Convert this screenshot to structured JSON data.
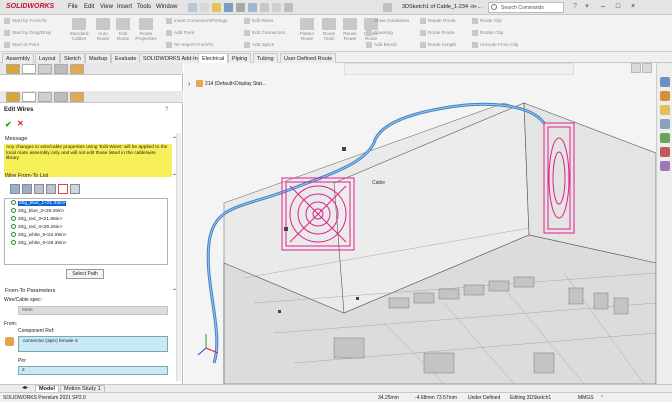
{
  "app": {
    "logo": "SOLIDWORKS",
    "document_title": "3DSketch1 of Cable_1-234 -in-...",
    "search_placeholder": "Search Commands"
  },
  "menu": [
    "File",
    "Edit",
    "View",
    "Insert",
    "Tools",
    "Window"
  ],
  "ribbon": {
    "col1": [
      "Start by From/To",
      "Start by Drag/Drop",
      "Start at Point"
    ],
    "big1": [
      {
        "label": "Standard\nCables"
      },
      {
        "label": "Auto\nRoute"
      },
      {
        "label": "Edit\nRoute"
      },
      {
        "label": "Route\nProperties"
      }
    ],
    "col2": [
      "Insert Connectors/Fittings",
      "Add Point",
      "Re-Import From/To"
    ],
    "col3": [
      "Edit Wires",
      "Edit Connectors",
      "Add Splice"
    ],
    "big2": [
      {
        "label": "Flatten\nRoute"
      },
      {
        "label": "Route\nTools"
      },
      {
        "label": "Reuse\nRoute"
      },
      {
        "label": "Create\nRoute"
      }
    ],
    "col4": [
      "Show Guidelines",
      "Covering",
      "Add Bends"
    ],
    "col5": [
      "Repair Route",
      "Route Route",
      "Route Length"
    ],
    "col6": [
      "Route Clip",
      "Rotate Clip",
      "Unroute From Clip"
    ]
  },
  "tabs": [
    "Assembly",
    "Layout",
    "Sketch",
    "Markup",
    "Evaluate",
    "SOLIDWORKS Add-Ins",
    "Electrical",
    "Piping",
    "Tubing",
    "User Defined Route"
  ],
  "active_tab": "Electrical",
  "panel": {
    "title": "Edit Wires",
    "message_header": "Message",
    "message": "Any changes to wire/cable properties using 'Edit Wires' will be applied to the local route assembly only and will not edit those listed in the cable/wire library",
    "wire_list_header": "Wire From-To List",
    "wires": [
      "20g_blue_1<21.33in>",
      "20g_blue_2<29.26in>",
      "20g_red_3<21.96in>",
      "20g_red_4<29.26in>",
      "20g_white_5<22.05in>",
      "20g_white_6<29.35in>"
    ],
    "select_path": "Select Path",
    "params_header": "From-To Parameters",
    "spec_label": "Wire/Cable spec:",
    "spec_value": "9965",
    "from_label": "From:",
    "comp_ref_label": "Component Ref:",
    "comp_ref_value": "connector (3pin) female-3",
    "pin_label": "Pin:",
    "pin_value": "2"
  },
  "viewport": {
    "tree_label": "214 (Default<Display Stat...",
    "cable_label": "Cable"
  },
  "bottom_tabs": [
    "Model",
    "Motion Study 1"
  ],
  "status": {
    "product": "SOLIDWORKS Premium 2021 SP2.0",
    "x": "34.25mm",
    "y": "-4.68mm 73.57mm",
    "mode": "Under Defined",
    "editing": "Editing 3DSketch1",
    "units": "MMGS"
  },
  "colors": {
    "accent_red": "#c8102e",
    "selection_blue": "#0a64d8",
    "message_yellow": "#f6ef57",
    "fan_magenta": "#e0208c",
    "cable_blue": "#3e82c8"
  }
}
